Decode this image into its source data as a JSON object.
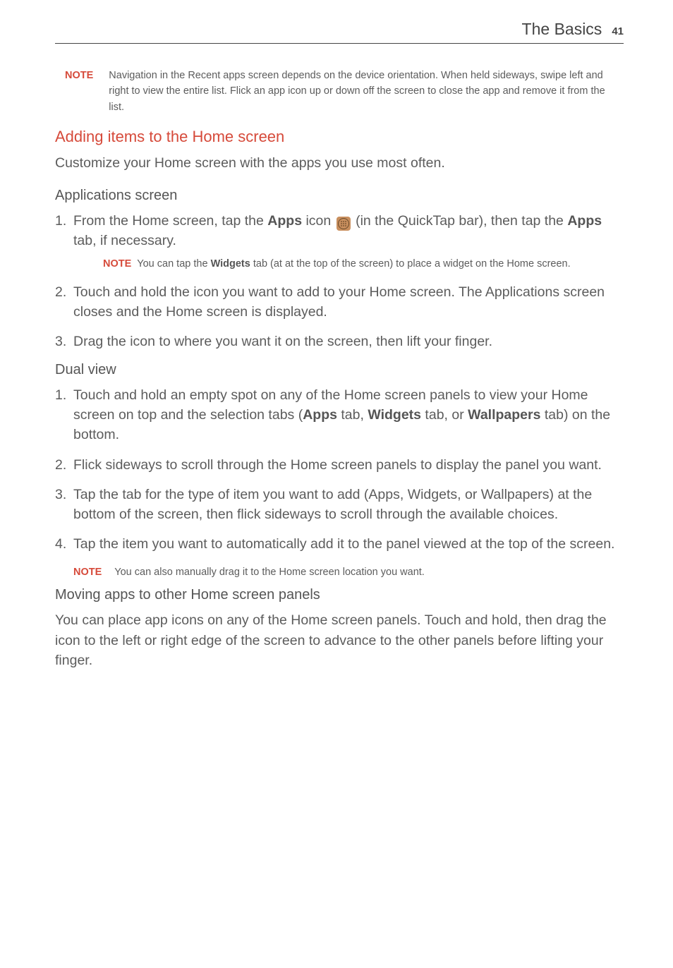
{
  "header": {
    "title": "The Basics",
    "page_number": "41"
  },
  "note_top": {
    "label": "NOTE",
    "text": "Navigation in the Recent apps screen depends on the device orientation. When held sideways, swipe left and right to view the entire list. Flick an app icon up or down off the screen to close the app and remove it from the list."
  },
  "section_adding": {
    "heading": "Adding items to the Home screen",
    "intro": "Customize your Home screen with the apps you use most often."
  },
  "applications_screen": {
    "heading": "Applications screen",
    "step1_a": "From the Home screen, tap the ",
    "step1_apps": "Apps",
    "step1_b": " icon ",
    "step1_c": " (in the QuickTap bar), then tap the ",
    "step1_apps2": "Apps",
    "step1_d": " tab, if necessary.",
    "note": {
      "label": "NOTE",
      "text_a": "You can tap the ",
      "widgets": "Widgets",
      "text_b": " tab (at at the top of the screen) to place a widget on the Home screen."
    },
    "step2": "Touch and hold the icon you want to add to your Home screen. The Applications screen closes and the Home screen is displayed.",
    "step3": "Drag the icon to where you want it on the screen, then lift your finger."
  },
  "dual_view": {
    "heading": "Dual view",
    "step1_a": "Touch and hold an empty spot on any of the Home screen panels to view your Home screen on top and the selection tabs (",
    "step1_apps": "Apps",
    "step1_b": " tab, ",
    "step1_widgets": "Widgets",
    "step1_c": " tab, or ",
    "step1_wall": "Wallpapers",
    "step1_d": " tab) on the bottom.",
    "step2": "Flick sideways to scroll through the Home screen panels to display the panel you want.",
    "step3": "Tap the tab for the type of item you want to add (Apps, Widgets, or Wallpapers) at the bottom of the screen, then flick sideways to scroll through the available choices.",
    "step4": "Tap the item you want to automatically add it to the panel viewed at the top of the screen.",
    "note": {
      "label": "NOTE",
      "text": "You can also manually drag it to the Home screen location you want."
    }
  },
  "moving_apps": {
    "heading": "Moving apps to other Home screen panels",
    "text": "You can place app icons on any of the Home screen panels. Touch and hold, then drag the icon to the left or right edge of the screen to advance to the other panels before lifting your finger."
  }
}
